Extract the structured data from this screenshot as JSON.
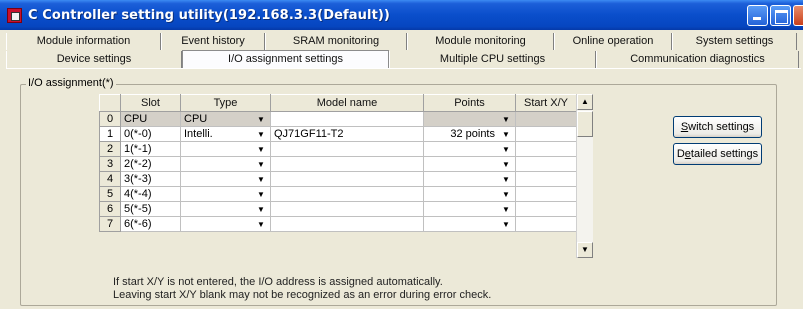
{
  "window": {
    "title": "C Controller setting utility(192.168.3.3(Default))"
  },
  "tabs": {
    "row1": [
      {
        "label": "Module information"
      },
      {
        "label": "Event history"
      },
      {
        "label": "SRAM monitoring"
      },
      {
        "label": "Module monitoring"
      },
      {
        "label": "Online operation"
      },
      {
        "label": "System settings"
      }
    ],
    "row2": [
      {
        "label": "Device settings"
      },
      {
        "label": "I/O assignment settings",
        "active": true
      },
      {
        "label": "Multiple CPU settings"
      },
      {
        "label": "Communication diagnostics"
      }
    ]
  },
  "io_group": {
    "legend": "I/O assignment(*)"
  },
  "table": {
    "headers": [
      "",
      "Slot",
      "Type",
      "Model name",
      "Points",
      "Start X/Y"
    ],
    "rows": [
      {
        "index": "0",
        "slot": "CPU",
        "type": "CPU",
        "model": "",
        "points": "",
        "start": ""
      },
      {
        "index": "1",
        "slot": "0(*-0)",
        "type": "Intelli.",
        "model": "QJ71GF11-T2",
        "points": "32 points",
        "start": ""
      },
      {
        "index": "2",
        "slot": "1(*-1)",
        "type": "",
        "model": "",
        "points": "",
        "start": ""
      },
      {
        "index": "3",
        "slot": "2(*-2)",
        "type": "",
        "model": "",
        "points": "",
        "start": ""
      },
      {
        "index": "4",
        "slot": "3(*-3)",
        "type": "",
        "model": "",
        "points": "",
        "start": ""
      },
      {
        "index": "5",
        "slot": "4(*-4)",
        "type": "",
        "model": "",
        "points": "",
        "start": ""
      },
      {
        "index": "6",
        "slot": "5(*-5)",
        "type": "",
        "model": "",
        "points": "",
        "start": ""
      },
      {
        "index": "7",
        "slot": "6(*-6)",
        "type": "",
        "model": "",
        "points": "",
        "start": ""
      }
    ]
  },
  "buttons": {
    "switch_settings_pre": "",
    "switch_settings_key": "S",
    "switch_settings_post": "witch settings",
    "detailed_settings_pre": "D",
    "detailed_settings_key": "e",
    "detailed_settings_post": "tailed settings"
  },
  "notes": {
    "line1": "If start X/Y is not entered, the I/O address is assigned automatically.",
    "line2": "Leaving start X/Y blank may not be recognized as an error during error check."
  },
  "icons": {
    "app": "controller-app-icon",
    "dropdown": "▼",
    "scroll_up": "▲",
    "scroll_down": "▼"
  },
  "colors": {
    "titlebar": "#0a4ecb",
    "dialog_bg": "#ece9d8",
    "button_border": "#003c74"
  }
}
